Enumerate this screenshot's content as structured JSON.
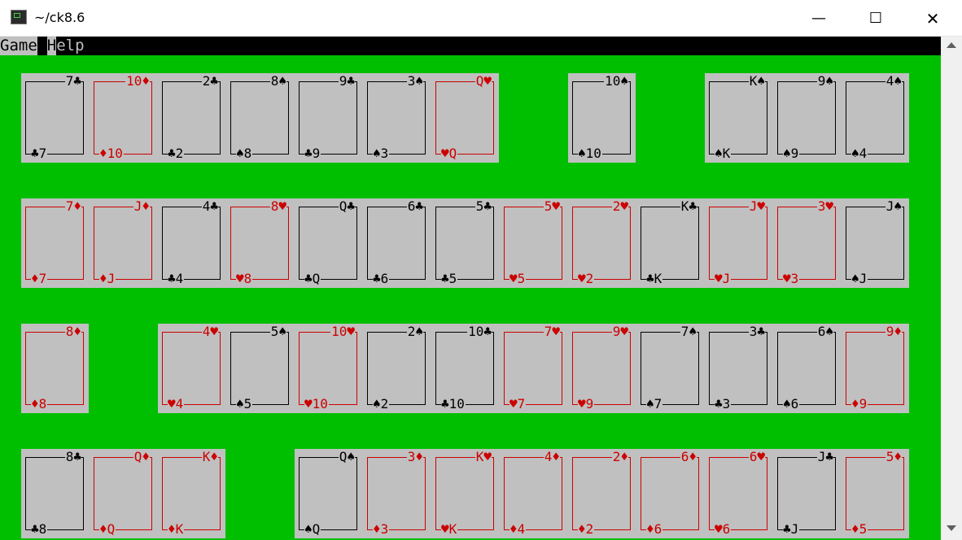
{
  "window": {
    "title": "~/ck8.6",
    "minimize": "—",
    "maximize": "☐",
    "close": "✕"
  },
  "menu": {
    "items": [
      "Game",
      "Help"
    ]
  },
  "piles": [
    {
      "id": "top-left",
      "cards": [
        [
          "7",
          "♣"
        ],
        [
          "10",
          "♦"
        ],
        [
          "2",
          "♣"
        ],
        [
          "8",
          "♠"
        ],
        [
          "9",
          "♣"
        ],
        [
          "3",
          "♠"
        ],
        [
          "Q",
          "♥"
        ]
      ]
    },
    {
      "id": "top-middle",
      "cards": [
        [
          "10",
          "♠"
        ]
      ]
    },
    {
      "id": "top-right",
      "cards": [
        [
          "K",
          "♠"
        ],
        [
          "9",
          "♠"
        ],
        [
          "4",
          "♠"
        ]
      ]
    },
    {
      "id": "row-2",
      "cards": [
        [
          "7",
          "♦"
        ],
        [
          "J",
          "♦"
        ],
        [
          "4",
          "♣"
        ],
        [
          "8",
          "♥"
        ],
        [
          "Q",
          "♣"
        ],
        [
          "6",
          "♣"
        ],
        [
          "5",
          "♣"
        ],
        [
          "5",
          "♥"
        ],
        [
          "2",
          "♥"
        ],
        [
          "K",
          "♣"
        ],
        [
          "J",
          "♥"
        ],
        [
          "3",
          "♥"
        ],
        [
          "J",
          "♠"
        ]
      ]
    },
    {
      "id": "row-3-left",
      "cards": [
        [
          "8",
          "♦"
        ]
      ]
    },
    {
      "id": "row-3",
      "cards": [
        [
          "4",
          "♥"
        ],
        [
          "5",
          "♠"
        ],
        [
          "10",
          "♥"
        ],
        [
          "2",
          "♠"
        ],
        [
          "10",
          "♣"
        ],
        [
          "7",
          "♥"
        ],
        [
          "9",
          "♥"
        ],
        [
          "7",
          "♠"
        ],
        [
          "3",
          "♣"
        ],
        [
          "6",
          "♠"
        ],
        [
          "9",
          "♦"
        ]
      ]
    },
    {
      "id": "row-4-left",
      "cards": [
        [
          "8",
          "♣"
        ],
        [
          "Q",
          "♦"
        ],
        [
          "K",
          "♦"
        ]
      ]
    },
    {
      "id": "row-4",
      "cards": [
        [
          "Q",
          "♠"
        ],
        [
          "3",
          "♦"
        ],
        [
          "K",
          "♥"
        ],
        [
          "4",
          "♦"
        ],
        [
          "2",
          "♦"
        ],
        [
          "6",
          "♦"
        ],
        [
          "6",
          "♥"
        ],
        [
          "J",
          "♣"
        ],
        [
          "5",
          "♦"
        ]
      ]
    }
  ],
  "colors": {
    "felt": "#00bf00",
    "card": "#c0c0c0",
    "red": "#cc0000",
    "black": "#000000"
  }
}
